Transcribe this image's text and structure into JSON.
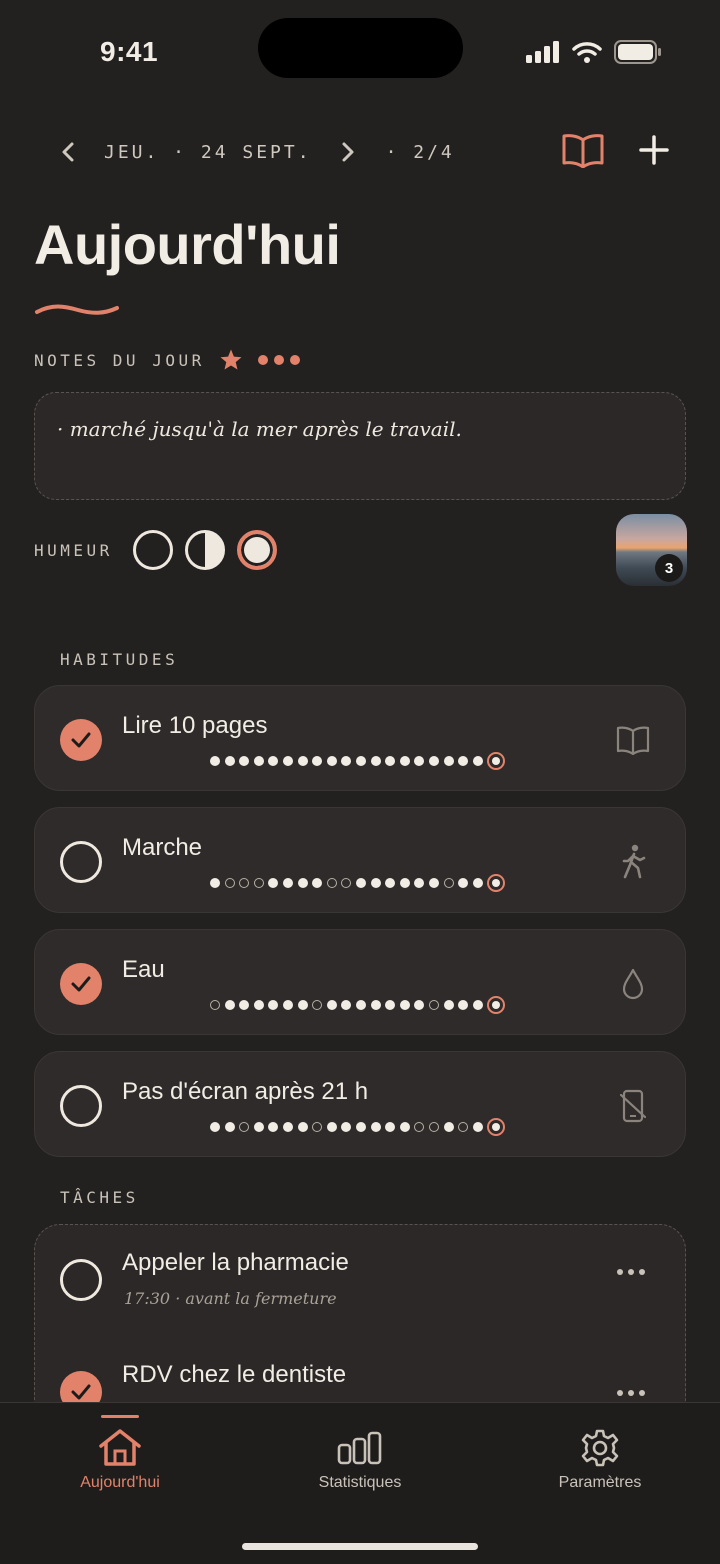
{
  "status_bar": {
    "time": "9:41"
  },
  "nav": {
    "date": "JEU. · 24 SEPT.",
    "page": "· 2/4"
  },
  "title": "Aujourd'hui",
  "notes": {
    "label": "NOTES DU JOUR",
    "text": "· marché jusqu'à la mer après le travail."
  },
  "mood": {
    "label": "HUMEUR",
    "options": [
      "empty",
      "half",
      "full"
    ],
    "selected": 2
  },
  "photo": {
    "count": "3"
  },
  "habits": {
    "label": "HABITUDES",
    "items": [
      {
        "name": "Lire 10 pages",
        "done": true,
        "icon": "book-icon",
        "history": [
          1,
          1,
          1,
          1,
          1,
          1,
          1,
          1,
          1,
          1,
          1,
          1,
          1,
          1,
          1,
          1,
          1,
          1,
          1,
          1
        ]
      },
      {
        "name": "Marche",
        "done": false,
        "icon": "walking-icon",
        "history": [
          1,
          0,
          0,
          0,
          1,
          1,
          1,
          1,
          0,
          0,
          1,
          1,
          1,
          1,
          1,
          1,
          0,
          1,
          1,
          1
        ]
      },
      {
        "name": "Eau",
        "done": true,
        "icon": "drop-icon",
        "history": [
          0,
          1,
          1,
          1,
          1,
          1,
          1,
          0,
          1,
          1,
          1,
          1,
          1,
          1,
          1,
          0,
          1,
          1,
          1,
          1
        ]
      },
      {
        "name": "Pas d'écran après 21 h",
        "done": false,
        "icon": "no-phone-icon",
        "history": [
          1,
          1,
          0,
          1,
          1,
          1,
          1,
          0,
          1,
          1,
          1,
          1,
          1,
          1,
          0,
          0,
          1,
          0,
          1,
          1
        ]
      }
    ]
  },
  "tasks": {
    "label": "TÂCHES",
    "items": [
      {
        "name": "Appeler la pharmacie",
        "meta": "17:30 · avant la fermeture",
        "done": false
      },
      {
        "name": "RDV chez le dentiste",
        "meta": "",
        "done": true
      }
    ]
  },
  "tabs": [
    {
      "label": "Aujourd'hui",
      "icon": "home-icon",
      "active": true
    },
    {
      "label": "Statistiques",
      "icon": "stats-icon",
      "active": false
    },
    {
      "label": "Paramètres",
      "icon": "gear-icon",
      "active": false
    }
  ],
  "colors": {
    "accent": "#e2826a",
    "background": "#232120",
    "card": "#2e2b2a"
  }
}
